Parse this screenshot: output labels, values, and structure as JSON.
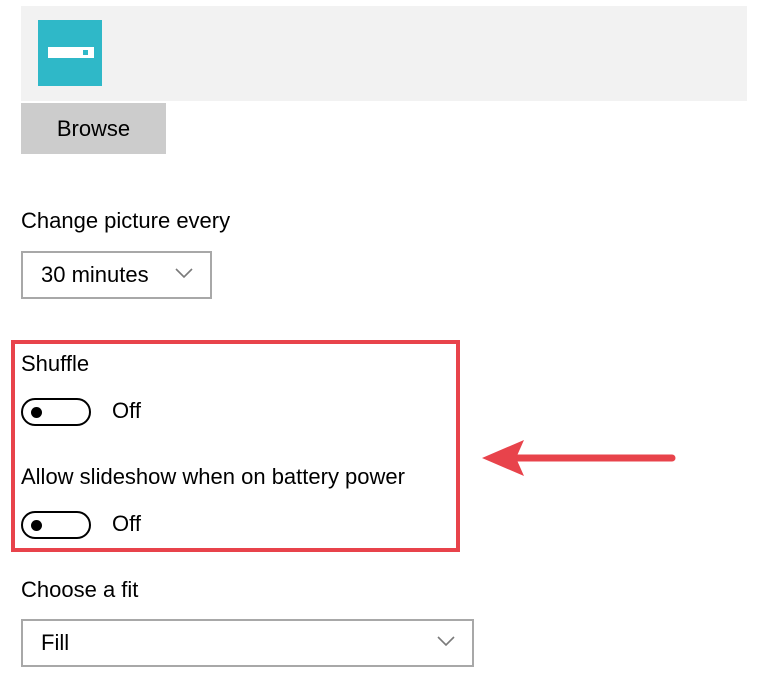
{
  "background": {
    "folder_icon": "folder-icon",
    "browse_label": "Browse"
  },
  "interval": {
    "label": "Change picture every",
    "value": "30 minutes",
    "chevron_icon": "chevron-down-icon"
  },
  "shuffle": {
    "label": "Shuffle",
    "state": "Off",
    "on": false
  },
  "battery": {
    "label": "Allow slideshow when on battery power",
    "state": "Off",
    "on": false
  },
  "fit": {
    "label": "Choose a fit",
    "value": "Fill",
    "chevron_icon": "chevron-down-icon"
  },
  "annotation": {
    "highlight_color": "#e8434b",
    "arrow_icon": "arrow-left-icon"
  },
  "colors": {
    "accent_tile": "#2fb8c8",
    "button_bg": "#cccccc",
    "panel_bg": "#f2f2f2"
  }
}
